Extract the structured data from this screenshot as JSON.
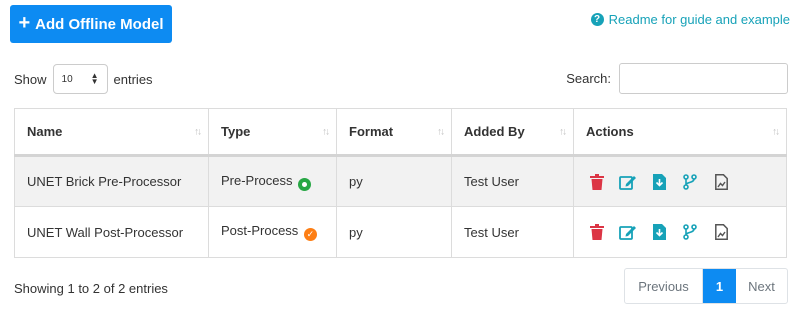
{
  "toolbar": {
    "add_label": "Add Offline Model",
    "readme_label": "Readme for guide and example"
  },
  "length": {
    "prefix": "Show",
    "value": "10",
    "suffix": "entries"
  },
  "search": {
    "label": "Search:",
    "value": ""
  },
  "table": {
    "columns": [
      "Name",
      "Type",
      "Format",
      "Added By",
      "Actions"
    ],
    "rows": [
      {
        "name": "UNET Brick Pre-Processor",
        "type": "Pre-Process",
        "type_status": "active",
        "format": "py",
        "added_by": "Test User"
      },
      {
        "name": "UNET Wall Post-Processor",
        "type": "Post-Process",
        "type_status": "verified",
        "format": "py",
        "added_by": "Test User"
      }
    ]
  },
  "info": "Showing 1 to 2 of 2 entries",
  "pagination": {
    "previous": "Previous",
    "current": "1",
    "next": "Next"
  },
  "colors": {
    "primary": "#0d8bf2",
    "info": "#17a2b8",
    "danger": "#dc3545",
    "success": "#28a745",
    "warning": "#fd7e14",
    "muted": "#6c757d"
  },
  "icons": [
    "plus-icon",
    "question-circle-icon",
    "sort-icon",
    "trash-icon",
    "edit-icon",
    "download-icon",
    "branch-icon",
    "file-chart-icon"
  ]
}
